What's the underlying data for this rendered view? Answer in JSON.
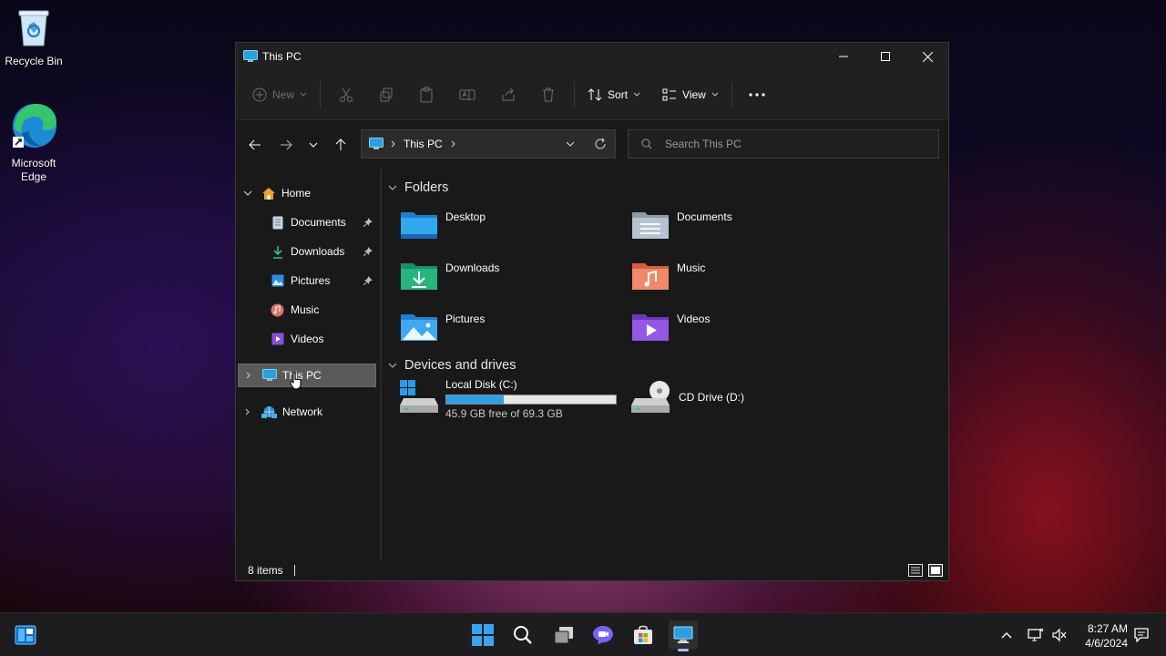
{
  "desktop": {
    "recycle_bin": "Recycle Bin",
    "edge_line1": "Microsoft",
    "edge_line2": "Edge"
  },
  "window": {
    "title": "This PC",
    "toolbar": {
      "new_label": "New",
      "sort_label": "Sort",
      "view_label": "View"
    },
    "address": {
      "location": "This PC"
    },
    "search": {
      "placeholder": "Search This PC"
    },
    "sidebar": {
      "home": "Home",
      "quick": [
        {
          "label": "Documents",
          "pinned": true
        },
        {
          "label": "Downloads",
          "pinned": true
        },
        {
          "label": "Pictures",
          "pinned": true
        },
        {
          "label": "Music",
          "pinned": false
        },
        {
          "label": "Videos",
          "pinned": false
        }
      ],
      "this_pc": "This PC",
      "network": "Network"
    },
    "content": {
      "folders_heading": "Folders",
      "folders": [
        "Desktop",
        "Documents",
        "Downloads",
        "Music",
        "Pictures",
        "Videos"
      ],
      "drives_heading": "Devices and drives",
      "drives": [
        {
          "name": "Local Disk (C:)",
          "free_text": "45.9 GB free of 69.3 GB",
          "used_fraction": 0.338
        },
        {
          "name": "CD Drive (D:)"
        }
      ]
    },
    "status": {
      "items": "8 items"
    }
  },
  "taskbar": {
    "time": "8:27 AM",
    "date": "4/6/2024"
  },
  "colors": {
    "accent": "#2e9fe0",
    "window_bg": "#1c1c1c",
    "selected_bg": "#5a5a5a"
  }
}
